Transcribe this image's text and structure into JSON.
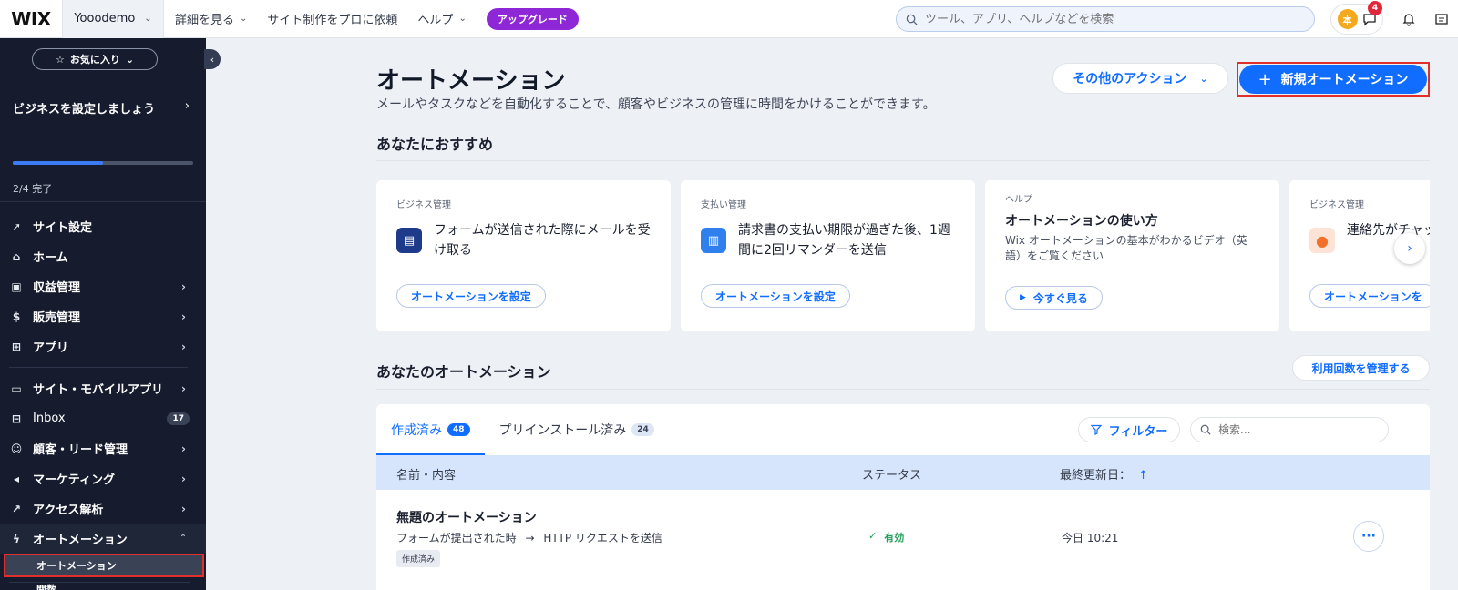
{
  "topbar": {
    "logo": "WIX",
    "site_name": "Yooodemo",
    "nav": [
      {
        "label": "詳細を見る",
        "has_dropdown": true
      },
      {
        "label": "サイト制作をプロに依頼",
        "has_dropdown": false
      },
      {
        "label": "ヘルプ",
        "has_dropdown": true
      }
    ],
    "upgrade_label": "アップグレード",
    "search_placeholder": "ツール、アプリ、ヘルプなどを検索",
    "avatar_initial": "本",
    "notification_count": "4"
  },
  "sidebar": {
    "favorites_label": "お気に入り",
    "setup_title": "ビジネスを設定しましょう",
    "setup_progress": 0.5,
    "setup_sub": "2/4 完了",
    "items_group1": [
      {
        "label": "サイト設定",
        "icon": "rocket-icon",
        "chevron": false
      },
      {
        "label": "ホーム",
        "icon": "home-icon",
        "chevron": false
      },
      {
        "label": "収益管理",
        "icon": "revenue-icon",
        "chevron": true
      },
      {
        "label": "販売管理",
        "icon": "dollar-icon",
        "chevron": true
      },
      {
        "label": "アプリ",
        "icon": "apps-icon",
        "chevron": true
      }
    ],
    "items_group2": [
      {
        "label": "サイト・モバイルアプリ",
        "icon": "devices-icon",
        "chevron": true
      },
      {
        "label": "Inbox",
        "icon": "inbox-icon",
        "count": "17"
      },
      {
        "label": "顧客・リード管理",
        "icon": "contacts-icon",
        "chevron": true
      },
      {
        "label": "マーケティング",
        "icon": "megaphone-icon",
        "chevron": true
      },
      {
        "label": "アクセス解析",
        "icon": "analytics-icon",
        "chevron": true
      },
      {
        "label": "オートメーション",
        "icon": "automation-icon",
        "chevron": true
      }
    ],
    "sub_items": [
      "オートメーション",
      "関数"
    ]
  },
  "main": {
    "title": "オートメーション",
    "description": "メールやタスクなどを自動化することで、顧客やビジネスの管理に時間をかけることができます。",
    "other_actions_label": "その他のアクション",
    "new_automation_label": "新規オートメーション",
    "recommended_heading": "あなたにおすすめ",
    "cards": [
      {
        "category": "ビジネス管理",
        "text": "フォームが送信された際にメールを受け取る",
        "button": "オートメーションを設定",
        "icon": "clipboard-icon",
        "icon_color": "#1e3a8a"
      },
      {
        "category": "支払い管理",
        "text": "請求書の支払い期限が過ぎた後、1週間に2回リマンダーを送信",
        "button": "オートメーションを設定",
        "icon": "invoice-icon",
        "icon_color": "#2f80ed"
      },
      {
        "category": "ヘルプ",
        "title": "オートメーションの使い方",
        "desc": "Wix オートメーションの基本がわかるビデオ（英語）をご覧ください",
        "button": "今すぐ見る",
        "icon": "play-icon"
      },
      {
        "category": "ビジネス管理",
        "text": "連絡先がチャットした時",
        "button": "オートメーションを",
        "icon": "people-icon",
        "icon_color": "#f2702a"
      }
    ],
    "your_heading": "あなたのオートメーション",
    "usage_label": "利用回数を管理する",
    "tabs": [
      {
        "label": "作成済み",
        "count": "48",
        "active": true
      },
      {
        "label": "プリインストール済み",
        "count": "24",
        "active": false
      }
    ],
    "filter_label": "フィルター",
    "table_search_placeholder": "検索...",
    "columns": {
      "name": "名前・内容",
      "status": "ステータス",
      "updated": "最終更新日："
    },
    "rows": [
      {
        "title": "無題のオートメーション",
        "trigger": "フォームが提出された時",
        "arrow": "→",
        "action": "HTTP リクエストを送信",
        "tag": "作成済み",
        "status": "有効",
        "updated": "今日 10:21"
      }
    ]
  }
}
